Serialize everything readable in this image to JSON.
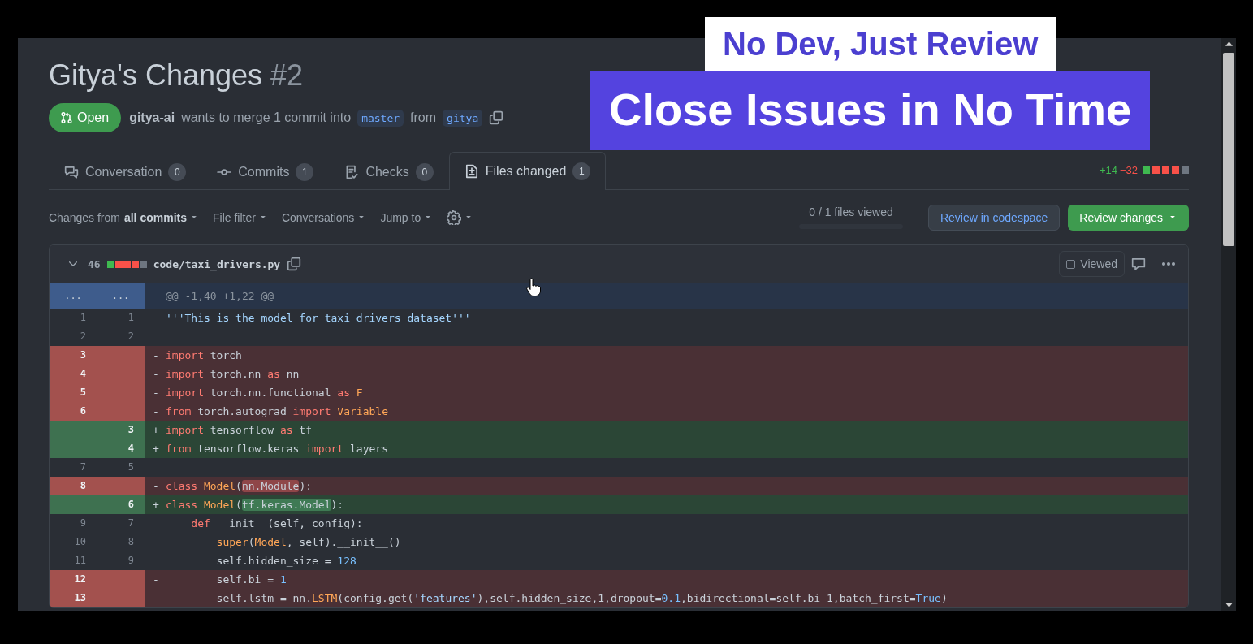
{
  "captions": [
    {
      "kind": "subtitle",
      "text": "No Dev, Just Review"
    },
    {
      "kind": "title",
      "text": "Close Issues in No Time"
    }
  ],
  "pr": {
    "title": "Gitya's Changes",
    "number": "#2",
    "status": "Open",
    "author": "gitya-ai",
    "summary": "wants to merge 1 commit into",
    "base": "master",
    "joiner": "from",
    "head": "gitya"
  },
  "tabs": [
    {
      "label": "Conversation",
      "count": "0",
      "selected": false
    },
    {
      "label": "Commits",
      "count": "1",
      "selected": false
    },
    {
      "label": "Checks",
      "count": "0",
      "selected": false
    },
    {
      "label": "Files changed",
      "count": "1",
      "selected": true
    }
  ],
  "diffstat": {
    "added": "+14",
    "removed": "−32",
    "blocks": [
      {
        "color": "#3fb950"
      },
      {
        "color": "#f85149"
      },
      {
        "color": "#f85149"
      },
      {
        "color": "#f85149"
      },
      {
        "color": "#6e7681"
      }
    ]
  },
  "toolbar": {
    "changes_prefix": "Changes from",
    "changes_value": "all commits",
    "filters": [
      "File filter",
      "Conversations",
      "Jump to"
    ],
    "progress": {
      "label": "0 / 1 files viewed",
      "level": 0
    },
    "codespace_button": "Review in codespace",
    "review_button": "Review changes"
  },
  "file": {
    "changes": "46",
    "blocks": [
      {
        "color": "#3fb950"
      },
      {
        "color": "#f85149"
      },
      {
        "color": "#f85149"
      },
      {
        "color": "#f85149"
      },
      {
        "color": "#6e7681"
      }
    ],
    "path": "code/taxi_drivers.py",
    "viewed_label": "Viewed",
    "viewed": false
  },
  "hunk": {
    "old": "...",
    "new": "...",
    "header": "@@ -1,40 +1,22 @@"
  },
  "lines": [
    {
      "kind": "context",
      "old": "1",
      "new": "1",
      "tokens": [
        {
          "text": "'''This is the model for taxi drivers dataset'''",
          "kind": "str"
        }
      ]
    },
    {
      "kind": "context",
      "old": "2",
      "new": "2"
    },
    {
      "kind": "del",
      "old": "3",
      "sign": "-",
      "tokens": [
        {
          "text": "import",
          "kind": "kw"
        },
        {
          "text": " torch",
          "kind": "plain"
        }
      ]
    },
    {
      "kind": "del",
      "old": "4",
      "sign": "-",
      "tokens": [
        {
          "text": "import",
          "kind": "kw"
        },
        {
          "text": " torch.nn ",
          "kind": "plain"
        },
        {
          "text": "as",
          "kind": "kw"
        },
        {
          "text": " nn",
          "kind": "plain"
        }
      ]
    },
    {
      "kind": "del",
      "old": "5",
      "sign": "-",
      "tokens": [
        {
          "text": "import",
          "kind": "kw"
        },
        {
          "text": " torch.nn.functional ",
          "kind": "plain"
        },
        {
          "text": "as",
          "kind": "kw"
        },
        {
          "text": " F",
          "kind": "cls"
        }
      ]
    },
    {
      "kind": "del",
      "old": "6",
      "sign": "-",
      "tokens": [
        {
          "text": "from",
          "kind": "kw"
        },
        {
          "text": " torch.autograd ",
          "kind": "plain"
        },
        {
          "text": "import",
          "kind": "kw"
        },
        {
          "text": " Variable",
          "kind": "cls"
        }
      ]
    },
    {
      "kind": "add",
      "new": "3",
      "sign": "+",
      "tokens": [
        {
          "text": "import",
          "kind": "kw"
        },
        {
          "text": " tensorflow ",
          "kind": "plain"
        },
        {
          "text": "as",
          "kind": "kw"
        },
        {
          "text": " tf",
          "kind": "plain"
        }
      ]
    },
    {
      "kind": "add",
      "new": "4",
      "sign": "+",
      "tokens": [
        {
          "text": "from",
          "kind": "kw"
        },
        {
          "text": " tensorflow.keras ",
          "kind": "plain"
        },
        {
          "text": "import",
          "kind": "kw"
        },
        {
          "text": " layers",
          "kind": "plain"
        }
      ]
    },
    {
      "kind": "context",
      "old": "7",
      "new": "5"
    },
    {
      "kind": "del",
      "old": "8",
      "sign": "-",
      "tokens": [
        {
          "text": "class",
          "kind": "kw"
        },
        {
          "text": " Model",
          "kind": "cls"
        },
        {
          "text": "(",
          "kind": "plain"
        },
        {
          "text": "nn.Module",
          "kind": "hl"
        },
        {
          "text": "):",
          "kind": "plain"
        }
      ]
    },
    {
      "kind": "add",
      "new": "6",
      "sign": "+",
      "tokens": [
        {
          "text": "class",
          "kind": "kw"
        },
        {
          "text": " Model",
          "kind": "cls"
        },
        {
          "text": "(",
          "kind": "plain"
        },
        {
          "text": "tf.keras.Model",
          "kind": "hl"
        },
        {
          "text": "):",
          "kind": "plain"
        }
      ]
    },
    {
      "kind": "context",
      "old": "9",
      "new": "7",
      "tokens": [
        {
          "text": "    def",
          "kind": "kw"
        },
        {
          "text": " __init__(self, config):",
          "kind": "plain"
        }
      ]
    },
    {
      "kind": "context",
      "old": "10",
      "new": "8",
      "tokens": [
        {
          "text": "        super",
          "kind": "cls"
        },
        {
          "text": "(",
          "kind": "plain"
        },
        {
          "text": "Model",
          "kind": "cls"
        },
        {
          "text": ", self).__init__()",
          "kind": "plain"
        }
      ]
    },
    {
      "kind": "context",
      "old": "11",
      "new": "9",
      "tokens": [
        {
          "text": "        self.hidden_size = ",
          "kind": "plain"
        },
        {
          "text": "128",
          "kind": "num"
        }
      ]
    },
    {
      "kind": "del",
      "old": "12",
      "sign": "-",
      "tokens": [
        {
          "text": "        self.bi = ",
          "kind": "plain"
        },
        {
          "text": "1",
          "kind": "num"
        }
      ]
    },
    {
      "kind": "del",
      "old": "13",
      "sign": "-",
      "tokens": [
        {
          "text": "        self.lstm = nn.",
          "kind": "plain"
        },
        {
          "text": "LSTM",
          "kind": "cls"
        },
        {
          "text": "(config.get(",
          "kind": "plain"
        },
        {
          "text": "'features'",
          "kind": "str"
        },
        {
          "text": "),self.hidden_size,1,dropout=",
          "kind": "plain"
        },
        {
          "text": "0.1",
          "kind": "num"
        },
        {
          "text": ",bidirectional=self.bi-1,batch_first=",
          "kind": "plain"
        },
        {
          "text": "True",
          "kind": "num"
        },
        {
          "text": ")",
          "kind": "plain"
        }
      ]
    }
  ]
}
